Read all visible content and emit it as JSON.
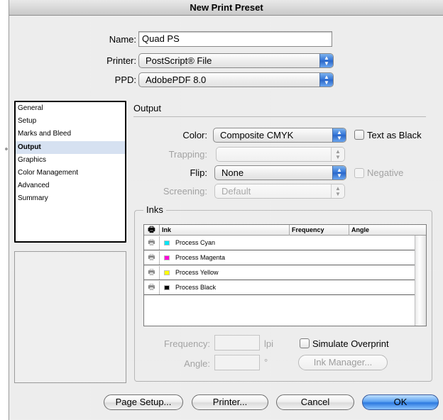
{
  "window": {
    "title": "New Print Preset"
  },
  "preset": {
    "name_label": "Name:",
    "name_value": "Quad PS",
    "printer_label": "Printer:",
    "printer_value": "PostScript® File",
    "ppd_label": "PPD:",
    "ppd_value": "AdobePDF 8.0"
  },
  "sidebar": {
    "items": [
      {
        "label": "General",
        "selected": false
      },
      {
        "label": "Setup",
        "selected": false
      },
      {
        "label": "Marks and Bleed",
        "selected": false
      },
      {
        "label": "Output",
        "selected": true
      },
      {
        "label": "Graphics",
        "selected": false
      },
      {
        "label": "Color Management",
        "selected": false
      },
      {
        "label": "Advanced",
        "selected": false
      },
      {
        "label": "Summary",
        "selected": false
      }
    ]
  },
  "output": {
    "section_title": "Output",
    "color_label": "Color:",
    "color_value": "Composite CMYK",
    "text_as_black_label": "Text as Black",
    "text_as_black_checked": false,
    "trapping_label": "Trapping:",
    "trapping_value": "",
    "flip_label": "Flip:",
    "flip_value": "None",
    "negative_label": "Negative",
    "negative_checked": false,
    "screening_label": "Screening:",
    "screening_value": "Default"
  },
  "inks": {
    "group_title": "Inks",
    "columns": [
      "Ink",
      "Frequency",
      "Angle"
    ],
    "rows": [
      {
        "name": "Process Cyan",
        "color": "#00e5f5"
      },
      {
        "name": "Process Magenta",
        "color": "#ff00d8"
      },
      {
        "name": "Process Yellow",
        "color": "#ffff00"
      },
      {
        "name": "Process Black",
        "color": "#000000"
      }
    ],
    "frequency_label": "Frequency:",
    "frequency_value": "",
    "frequency_unit": "lpi",
    "angle_label": "Angle:",
    "angle_value": "",
    "angle_unit": "°",
    "simulate_overprint_label": "Simulate Overprint",
    "simulate_overprint_checked": false,
    "ink_manager_label": "Ink Manager..."
  },
  "buttons": {
    "page_setup": "Page Setup...",
    "printer": "Printer...",
    "cancel": "Cancel",
    "ok": "OK"
  },
  "icons": {
    "popup_arrows": "updown-arrows-icon",
    "print_toggle": "printer-icon"
  }
}
